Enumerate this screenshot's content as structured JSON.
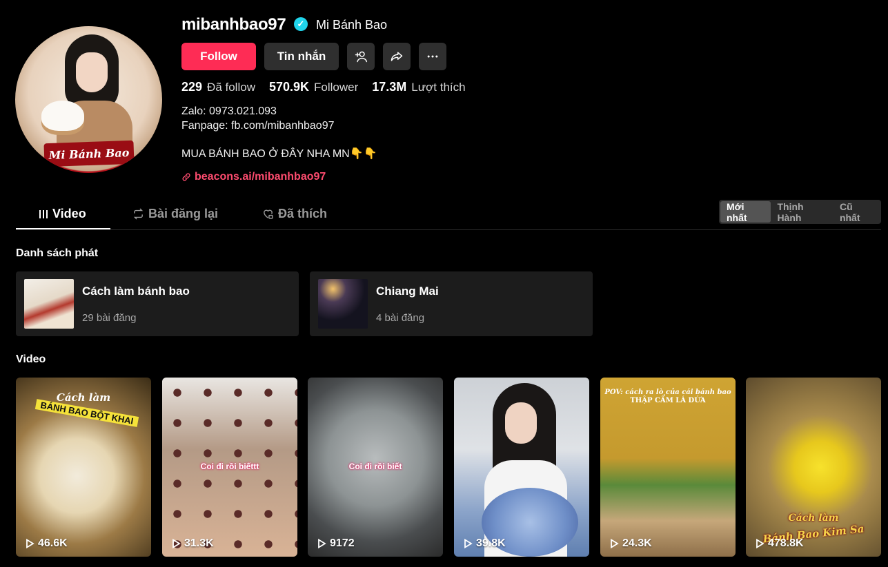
{
  "profile": {
    "username": "mibanhbao97",
    "nickname": "Mi Bánh Bao",
    "avatar_banner": "Mi Bánh Bao",
    "verified_icon": "✓",
    "follow_label": "Follow",
    "message_label": "Tin nhắn",
    "stats": {
      "following_count": "229",
      "following_label": "Đã follow",
      "followers_count": "570.9K",
      "followers_label": "Follower",
      "likes_count": "17.3M",
      "likes_label": "Lượt thích"
    },
    "bio_line1": "Zalo: 0973.021.093",
    "bio_line2": "Fanpage: fb.com/mibanhbao97",
    "bio_line3": "MUA BÁNH BAO Ở ĐÂY NHA MN👇👇",
    "link": "beacons.ai/mibanhbao97"
  },
  "tabs": {
    "video": "Video",
    "repost": "Bài đăng lại",
    "liked": "Đã thích"
  },
  "sort": {
    "newest": "Mới nhất",
    "trending": "Thịnh Hành",
    "oldest": "Cũ nhất"
  },
  "playlists": {
    "title": "Danh sách phát",
    "items": [
      {
        "name": "Cách làm bánh bao",
        "count": "29 bài đăng"
      },
      {
        "name": "Chiang Mai",
        "count": "4 bài đăng"
      }
    ]
  },
  "videos": {
    "title": "Video",
    "items": [
      {
        "views": "46.6K",
        "overlay": "BÁNH BAO BỘT KHAI",
        "overlay2": "Cách làm"
      },
      {
        "views": "31.3K",
        "overlay": "Coi đi rồi biếttt"
      },
      {
        "views": "9172",
        "overlay": "Coi đi rồi biết"
      },
      {
        "views": "39.8K",
        "overlay": ""
      },
      {
        "views": "24.3K",
        "overlay": "POV: cách ra lò của cái bánh bao",
        "overlay2": "THẬP CẨM LÁ DỨA"
      },
      {
        "views": "478.8K",
        "overlay": "Cách làm",
        "overlay2": "Bánh Bao Kim Sa"
      }
    ]
  },
  "colors": {
    "accent": "#fe2c55",
    "link": "#fe4c6f",
    "verified": "#20d5ec"
  }
}
